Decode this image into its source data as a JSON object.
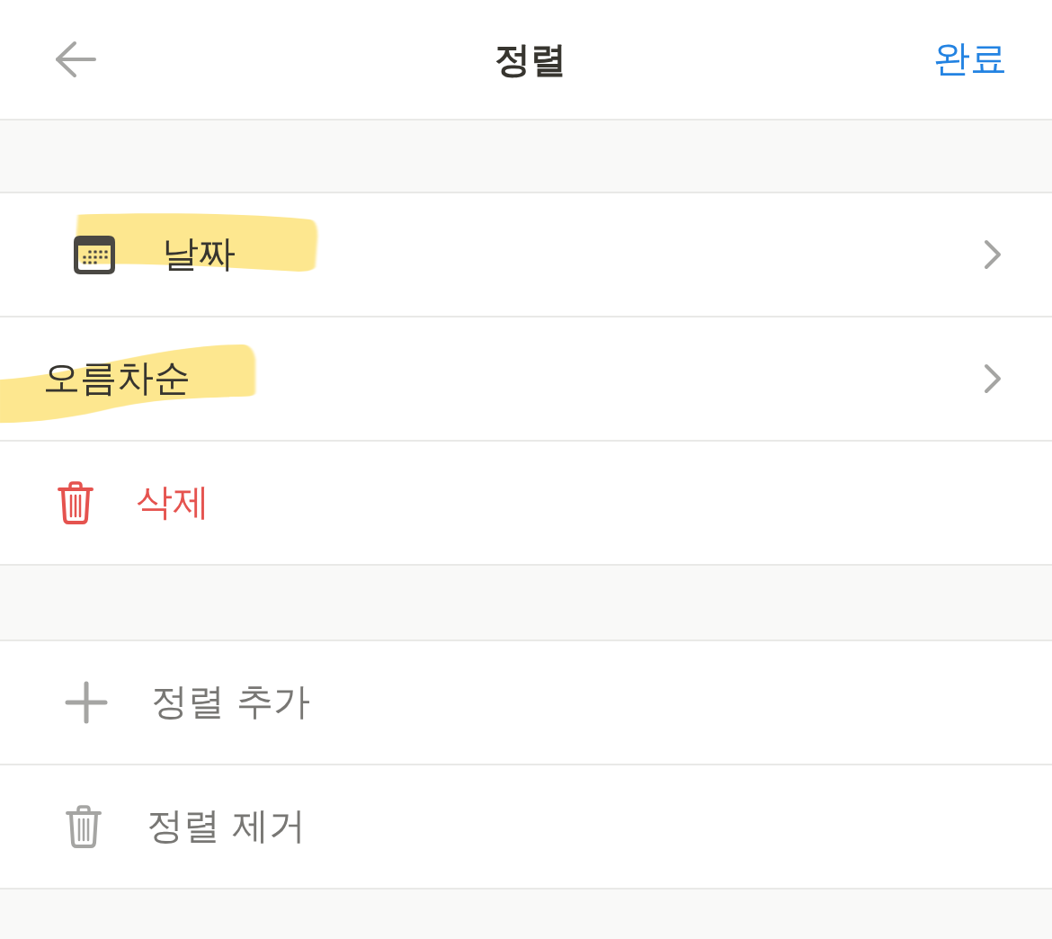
{
  "header": {
    "title": "정렬",
    "done": "완료"
  },
  "sections": [
    {
      "rows": [
        {
          "kind": "property",
          "label": "날짜",
          "highlighted": true
        },
        {
          "kind": "direction",
          "label": "오름차순",
          "highlighted": true
        },
        {
          "kind": "delete",
          "label": "삭제",
          "highlighted": false
        }
      ]
    },
    {
      "rows": [
        {
          "kind": "add",
          "label": "정렬 추가",
          "highlighted": false
        },
        {
          "kind": "remove",
          "label": "정렬 제거",
          "highlighted": false
        }
      ]
    }
  ]
}
